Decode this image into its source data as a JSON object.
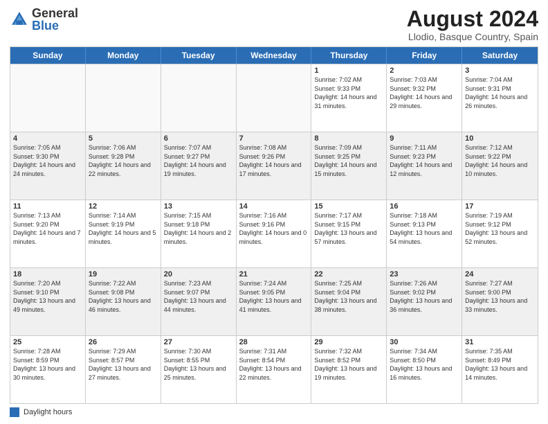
{
  "header": {
    "logo_general": "General",
    "logo_blue": "Blue",
    "title": "August 2024",
    "subtitle": "Llodio, Basque Country, Spain"
  },
  "days": [
    "Sunday",
    "Monday",
    "Tuesday",
    "Wednesday",
    "Thursday",
    "Friday",
    "Saturday"
  ],
  "weeks": [
    [
      {
        "day": "",
        "text": "",
        "empty": true
      },
      {
        "day": "",
        "text": "",
        "empty": true
      },
      {
        "day": "",
        "text": "",
        "empty": true
      },
      {
        "day": "",
        "text": "",
        "empty": true
      },
      {
        "day": "1",
        "text": "Sunrise: 7:02 AM\nSunset: 9:33 PM\nDaylight: 14 hours and 31 minutes.",
        "empty": false
      },
      {
        "day": "2",
        "text": "Sunrise: 7:03 AM\nSunset: 9:32 PM\nDaylight: 14 hours and 29 minutes.",
        "empty": false
      },
      {
        "day": "3",
        "text": "Sunrise: 7:04 AM\nSunset: 9:31 PM\nDaylight: 14 hours and 26 minutes.",
        "empty": false
      }
    ],
    [
      {
        "day": "4",
        "text": "Sunrise: 7:05 AM\nSunset: 9:30 PM\nDaylight: 14 hours and 24 minutes.",
        "empty": false
      },
      {
        "day": "5",
        "text": "Sunrise: 7:06 AM\nSunset: 9:28 PM\nDaylight: 14 hours and 22 minutes.",
        "empty": false
      },
      {
        "day": "6",
        "text": "Sunrise: 7:07 AM\nSunset: 9:27 PM\nDaylight: 14 hours and 19 minutes.",
        "empty": false
      },
      {
        "day": "7",
        "text": "Sunrise: 7:08 AM\nSunset: 9:26 PM\nDaylight: 14 hours and 17 minutes.",
        "empty": false
      },
      {
        "day": "8",
        "text": "Sunrise: 7:09 AM\nSunset: 9:25 PM\nDaylight: 14 hours and 15 minutes.",
        "empty": false
      },
      {
        "day": "9",
        "text": "Sunrise: 7:11 AM\nSunset: 9:23 PM\nDaylight: 14 hours and 12 minutes.",
        "empty": false
      },
      {
        "day": "10",
        "text": "Sunrise: 7:12 AM\nSunset: 9:22 PM\nDaylight: 14 hours and 10 minutes.",
        "empty": false
      }
    ],
    [
      {
        "day": "11",
        "text": "Sunrise: 7:13 AM\nSunset: 9:20 PM\nDaylight: 14 hours and 7 minutes.",
        "empty": false
      },
      {
        "day": "12",
        "text": "Sunrise: 7:14 AM\nSunset: 9:19 PM\nDaylight: 14 hours and 5 minutes.",
        "empty": false
      },
      {
        "day": "13",
        "text": "Sunrise: 7:15 AM\nSunset: 9:18 PM\nDaylight: 14 hours and 2 minutes.",
        "empty": false
      },
      {
        "day": "14",
        "text": "Sunrise: 7:16 AM\nSunset: 9:16 PM\nDaylight: 14 hours and 0 minutes.",
        "empty": false
      },
      {
        "day": "15",
        "text": "Sunrise: 7:17 AM\nSunset: 9:15 PM\nDaylight: 13 hours and 57 minutes.",
        "empty": false
      },
      {
        "day": "16",
        "text": "Sunrise: 7:18 AM\nSunset: 9:13 PM\nDaylight: 13 hours and 54 minutes.",
        "empty": false
      },
      {
        "day": "17",
        "text": "Sunrise: 7:19 AM\nSunset: 9:12 PM\nDaylight: 13 hours and 52 minutes.",
        "empty": false
      }
    ],
    [
      {
        "day": "18",
        "text": "Sunrise: 7:20 AM\nSunset: 9:10 PM\nDaylight: 13 hours and 49 minutes.",
        "empty": false
      },
      {
        "day": "19",
        "text": "Sunrise: 7:22 AM\nSunset: 9:08 PM\nDaylight: 13 hours and 46 minutes.",
        "empty": false
      },
      {
        "day": "20",
        "text": "Sunrise: 7:23 AM\nSunset: 9:07 PM\nDaylight: 13 hours and 44 minutes.",
        "empty": false
      },
      {
        "day": "21",
        "text": "Sunrise: 7:24 AM\nSunset: 9:05 PM\nDaylight: 13 hours and 41 minutes.",
        "empty": false
      },
      {
        "day": "22",
        "text": "Sunrise: 7:25 AM\nSunset: 9:04 PM\nDaylight: 13 hours and 38 minutes.",
        "empty": false
      },
      {
        "day": "23",
        "text": "Sunrise: 7:26 AM\nSunset: 9:02 PM\nDaylight: 13 hours and 36 minutes.",
        "empty": false
      },
      {
        "day": "24",
        "text": "Sunrise: 7:27 AM\nSunset: 9:00 PM\nDaylight: 13 hours and 33 minutes.",
        "empty": false
      }
    ],
    [
      {
        "day": "25",
        "text": "Sunrise: 7:28 AM\nSunset: 8:59 PM\nDaylight: 13 hours and 30 minutes.",
        "empty": false
      },
      {
        "day": "26",
        "text": "Sunrise: 7:29 AM\nSunset: 8:57 PM\nDaylight: 13 hours and 27 minutes.",
        "empty": false
      },
      {
        "day": "27",
        "text": "Sunrise: 7:30 AM\nSunset: 8:55 PM\nDaylight: 13 hours and 25 minutes.",
        "empty": false
      },
      {
        "day": "28",
        "text": "Sunrise: 7:31 AM\nSunset: 8:54 PM\nDaylight: 13 hours and 22 minutes.",
        "empty": false
      },
      {
        "day": "29",
        "text": "Sunrise: 7:32 AM\nSunset: 8:52 PM\nDaylight: 13 hours and 19 minutes.",
        "empty": false
      },
      {
        "day": "30",
        "text": "Sunrise: 7:34 AM\nSunset: 8:50 PM\nDaylight: 13 hours and 16 minutes.",
        "empty": false
      },
      {
        "day": "31",
        "text": "Sunrise: 7:35 AM\nSunset: 8:49 PM\nDaylight: 13 hours and 14 minutes.",
        "empty": false
      }
    ]
  ],
  "footer": {
    "legend_label": "Daylight hours"
  }
}
